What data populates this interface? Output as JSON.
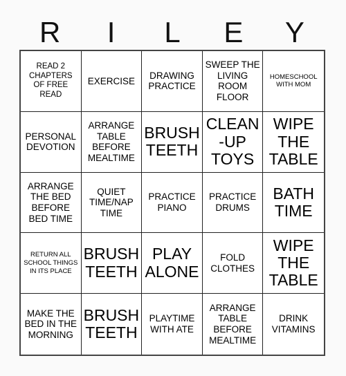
{
  "card": {
    "title_letters": [
      "R",
      "I",
      "L",
      "E",
      "Y"
    ],
    "colors": {
      "page_background": "#fafafa",
      "cell_background": "#ffffff",
      "grid_border": "#222222",
      "outer_border": "#444444",
      "text": "#000000"
    },
    "rows": [
      [
        {
          "text": "READ 2 CHAPTERS OF FREE READ",
          "size": "s"
        },
        {
          "text": "EXERCISE",
          "size": "m"
        },
        {
          "text": "DRAWING PRACTICE",
          "size": "m"
        },
        {
          "text": "SWEEP THE LIVING ROOM FLOOR",
          "size": "m"
        },
        {
          "text": "HOMESCHOOL WITH MOM",
          "size": "xs"
        }
      ],
      [
        {
          "text": "PERSONAL DEVOTION",
          "size": "m"
        },
        {
          "text": "ARRANGE TABLE BEFORE MEALTIME",
          "size": "m"
        },
        {
          "text": "BRUSH TEETH",
          "size": "xl"
        },
        {
          "text": "CLEAN-UP TOYS",
          "size": "xl"
        },
        {
          "text": "WIPE THE TABLE",
          "size": "xl"
        }
      ],
      [
        {
          "text": "ARRANGE THE BED BEFORE BED TIME",
          "size": "m"
        },
        {
          "text": "QUIET TIME/NAP TIME",
          "size": "m"
        },
        {
          "text": "PRACTICE PIANO",
          "size": "m"
        },
        {
          "text": "PRACTICE DRUMS",
          "size": "m"
        },
        {
          "text": "BATH TIME",
          "size": "xl"
        }
      ],
      [
        {
          "text": "RETURN ALL SCHOOL THINGS IN ITS PLACE",
          "size": "xs"
        },
        {
          "text": "BRUSH TEETH",
          "size": "xl"
        },
        {
          "text": "PLAY ALONE",
          "size": "xl"
        },
        {
          "text": "FOLD CLOTHES",
          "size": "m"
        },
        {
          "text": "WIPE THE TABLE",
          "size": "xl"
        }
      ],
      [
        {
          "text": "MAKE THE BED IN THE MORNING",
          "size": "m"
        },
        {
          "text": "BRUSH TEETH",
          "size": "xl"
        },
        {
          "text": "PLAYTIME WITH ATE",
          "size": "m"
        },
        {
          "text": "ARRANGE TABLE BEFORE MEALTIME",
          "size": "m"
        },
        {
          "text": "DRINK VITAMINS",
          "size": "m"
        }
      ]
    ]
  }
}
